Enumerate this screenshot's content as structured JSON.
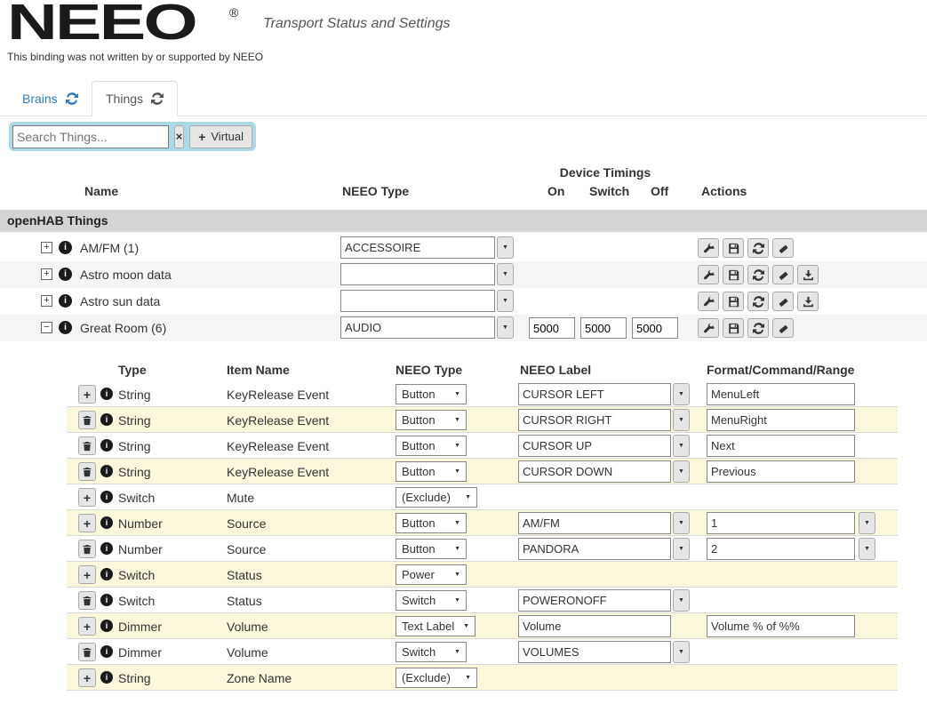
{
  "header": {
    "logo": "NEEO",
    "registered": "®",
    "subtitle": "Transport Status and Settings",
    "disclaimer": "This binding was not written by or supported by NEEO"
  },
  "tabs": {
    "brains": "Brains",
    "things": "Things"
  },
  "search": {
    "placeholder": "Search Things...",
    "virtual_label": "Virtual"
  },
  "icons": {
    "clear": "×",
    "plus": "+",
    "expand": "+",
    "collapse": "−",
    "caret": "▼",
    "info": "i"
  },
  "colors": {
    "accent_blue": "#337ab7",
    "search_bg": "#add8e6",
    "group_bar_bg": "#d3d3d3",
    "row_alt_bg": "#f5f5f5",
    "row_warning_bg": "#fbf7dc",
    "button_bg": "#e6e6e6"
  },
  "things_table": {
    "group_header": "openHAB Things",
    "headers": {
      "name": "Name",
      "neeo_type": "NEEO Type",
      "device_timings": "Device Timings",
      "on": "On",
      "switch": "Switch",
      "off": "Off",
      "actions": "Actions"
    },
    "rows": [
      {
        "name": "AM/FM (1)",
        "neeo_type": "ACCESSOIRE",
        "expanded": false
      },
      {
        "name": "Astro moon data",
        "neeo_type": "",
        "expanded": false
      },
      {
        "name": "Astro sun data",
        "neeo_type": "",
        "expanded": false
      },
      {
        "name": "Great Room (6)",
        "neeo_type": "AUDIO",
        "expanded": true,
        "timing_on": "5000",
        "timing_switch": "5000",
        "timing_off": "5000"
      }
    ]
  },
  "channels_table": {
    "headers": {
      "type": "Type",
      "item_name": "Item Name",
      "neeo_type": "NEEO Type",
      "neeo_label": "NEEO Label",
      "format": "Format/Command/Range"
    },
    "rows": [
      {
        "type": "String",
        "item_name": "KeyRelease Event",
        "neeo_type": "Button",
        "neeo_label": "CURSOR LEFT",
        "format": "MenuLeft"
      },
      {
        "type": "String",
        "item_name": "KeyRelease Event",
        "neeo_type": "Button",
        "neeo_label": "CURSOR RIGHT",
        "format": "MenuRight"
      },
      {
        "type": "String",
        "item_name": "KeyRelease Event",
        "neeo_type": "Button",
        "neeo_label": "CURSOR UP",
        "format": "Next"
      },
      {
        "type": "String",
        "item_name": "KeyRelease Event",
        "neeo_type": "Button",
        "neeo_label": "CURSOR DOWN",
        "format": "Previous"
      },
      {
        "type": "Switch",
        "item_name": "Mute",
        "neeo_type": "(Exclude)"
      },
      {
        "type": "Number",
        "item_name": "Source",
        "neeo_type": "Button",
        "neeo_label": "AM/FM",
        "format": "1"
      },
      {
        "type": "Number",
        "item_name": "Source",
        "neeo_type": "Button",
        "neeo_label": "PANDORA",
        "format": "2"
      },
      {
        "type": "Switch",
        "item_name": "Status",
        "neeo_type": "Power"
      },
      {
        "type": "Switch",
        "item_name": "Status",
        "neeo_type": "Switch",
        "neeo_label": "POWERONOFF"
      },
      {
        "type": "Dimmer",
        "item_name": "Volume",
        "neeo_type": "Text Label",
        "neeo_label": "Volume",
        "format": "Volume % of %%"
      },
      {
        "type": "Dimmer",
        "item_name": "Volume",
        "neeo_type": "Switch",
        "neeo_label": "VOLUMES"
      },
      {
        "type": "String",
        "item_name": "Zone Name",
        "neeo_type": "(Exclude)"
      }
    ]
  }
}
